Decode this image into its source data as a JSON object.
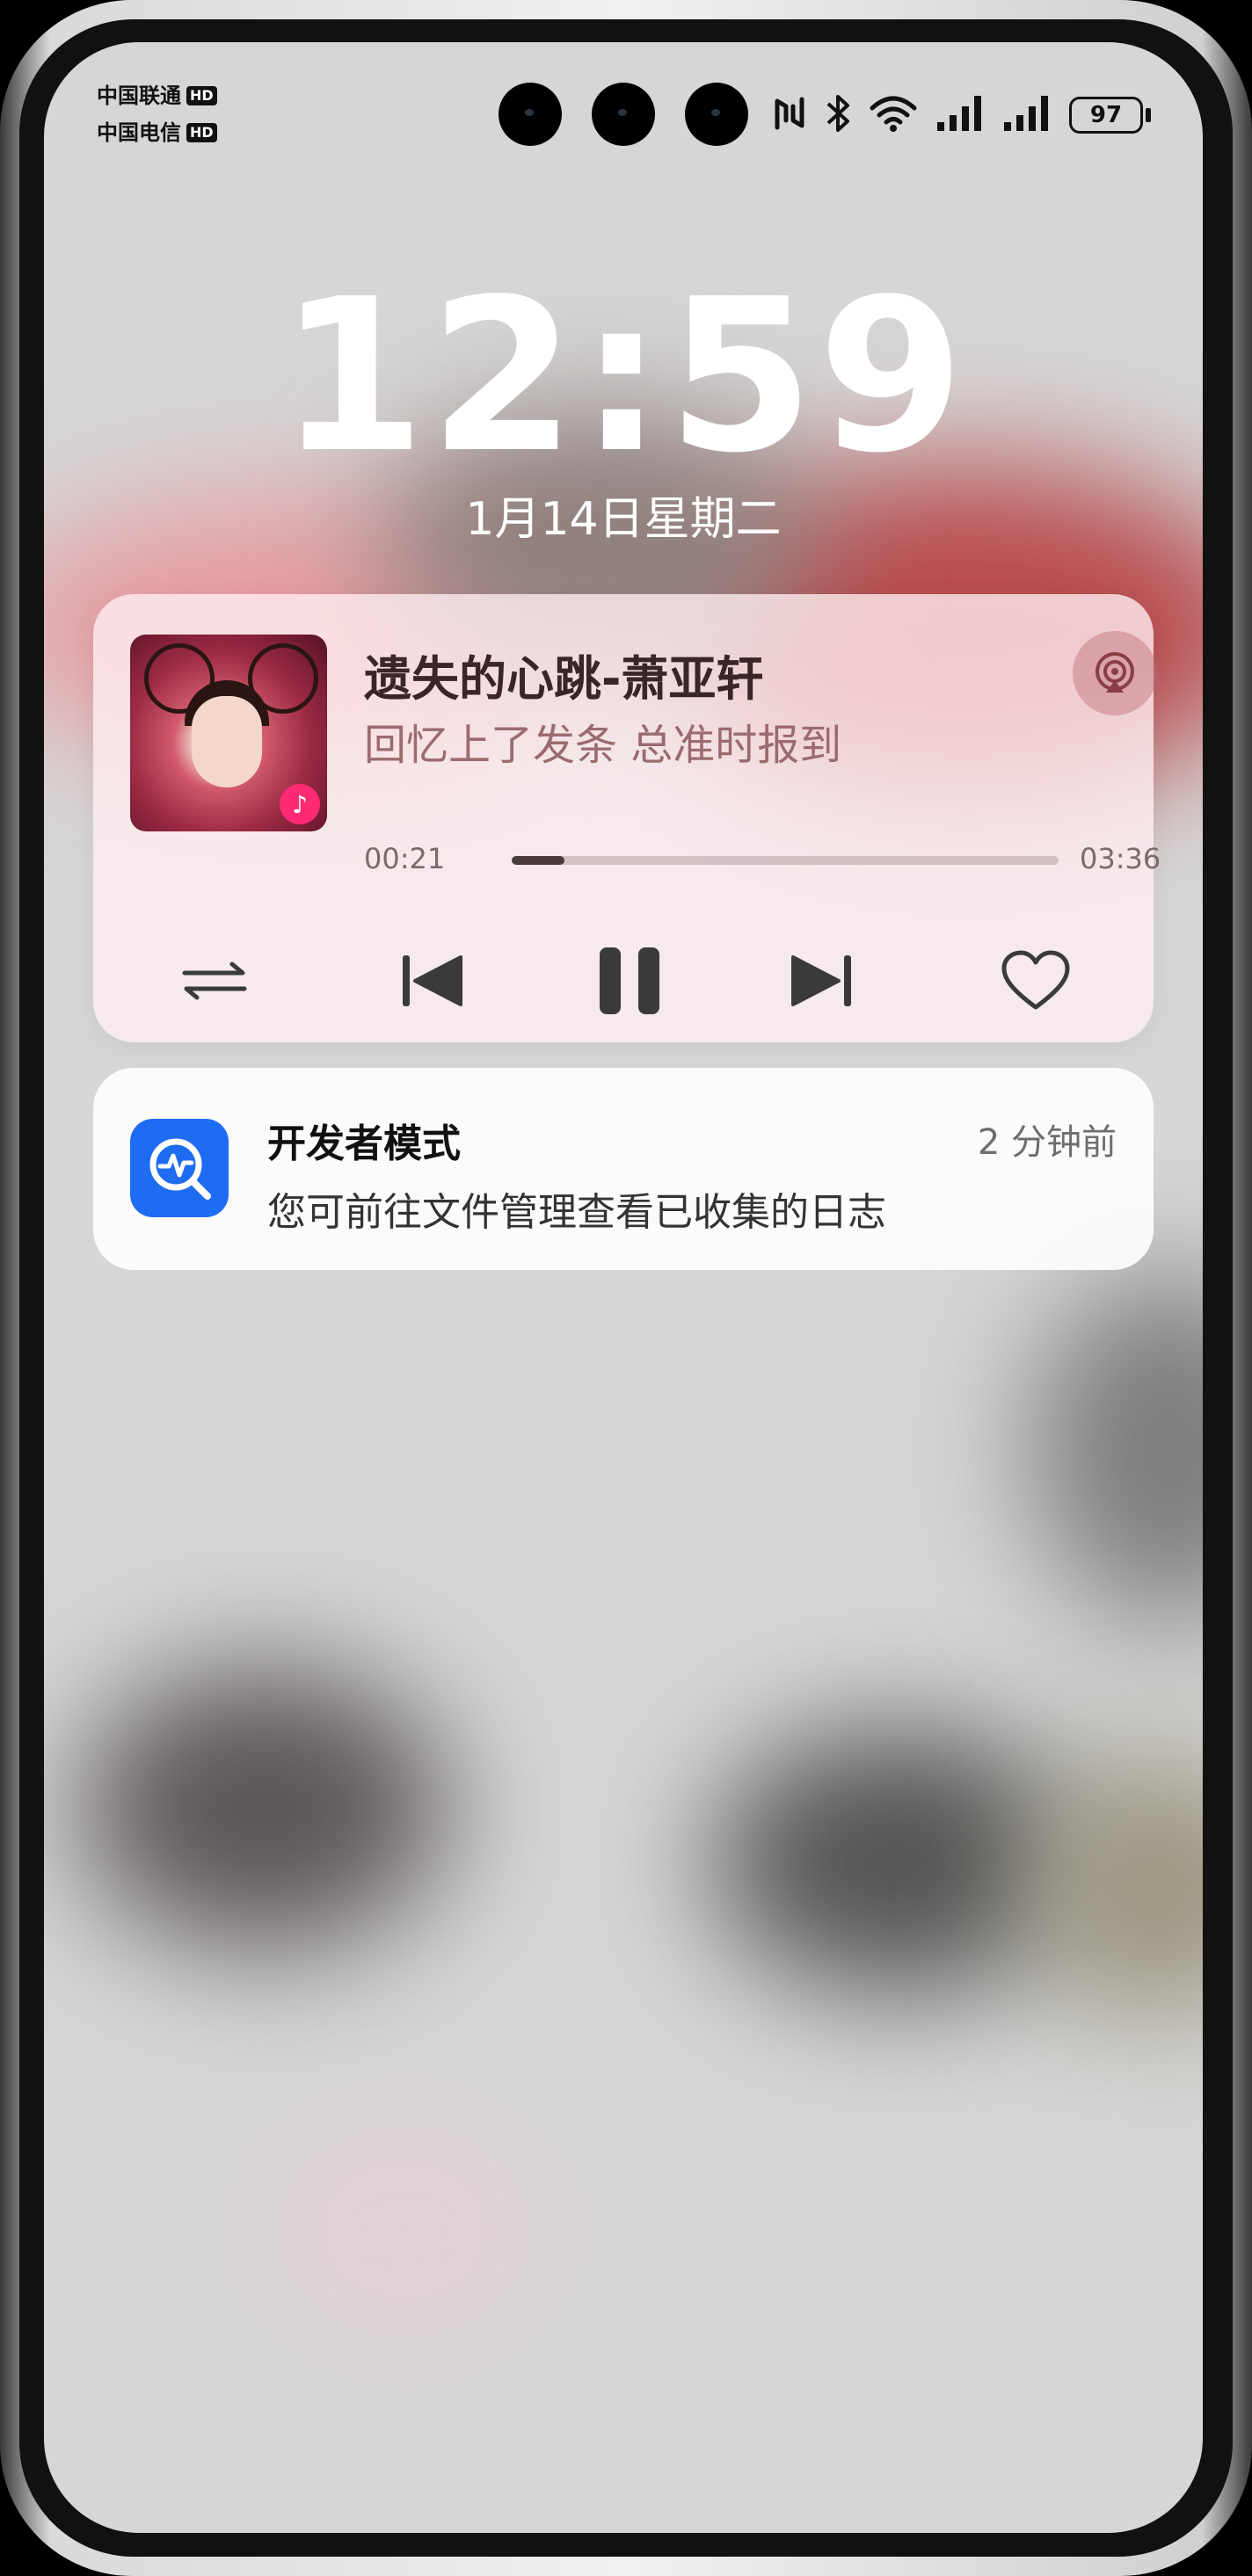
{
  "status_bar": {
    "carrier_1": "中国联通",
    "carrier_2": "中国电信",
    "hd_label": "HD",
    "battery_level": "97",
    "icons": [
      "nfc-icon",
      "bluetooth-icon",
      "wifi-icon",
      "signal-icon",
      "signal-icon",
      "battery-icon"
    ]
  },
  "lockscreen": {
    "time": "12:59",
    "date": "1月14日星期二"
  },
  "music_card": {
    "song_title": "遗失的心跳-萧亚轩",
    "lyric": "回忆上了发条 总准时报到",
    "current_time": "00:21",
    "duration": "03:36",
    "progress": 0.097,
    "controls": [
      "repeat-icon",
      "previous-icon",
      "pause-icon",
      "next-icon",
      "heart-icon"
    ]
  },
  "notification": {
    "app_title": "开发者模式",
    "time_ago": "2 分钟前",
    "body": "您可前往文件管理查看已收集的日志"
  },
  "colors": {
    "accent_pink": "#ff2a74",
    "app_icon_blue": "#1e6cf2"
  }
}
